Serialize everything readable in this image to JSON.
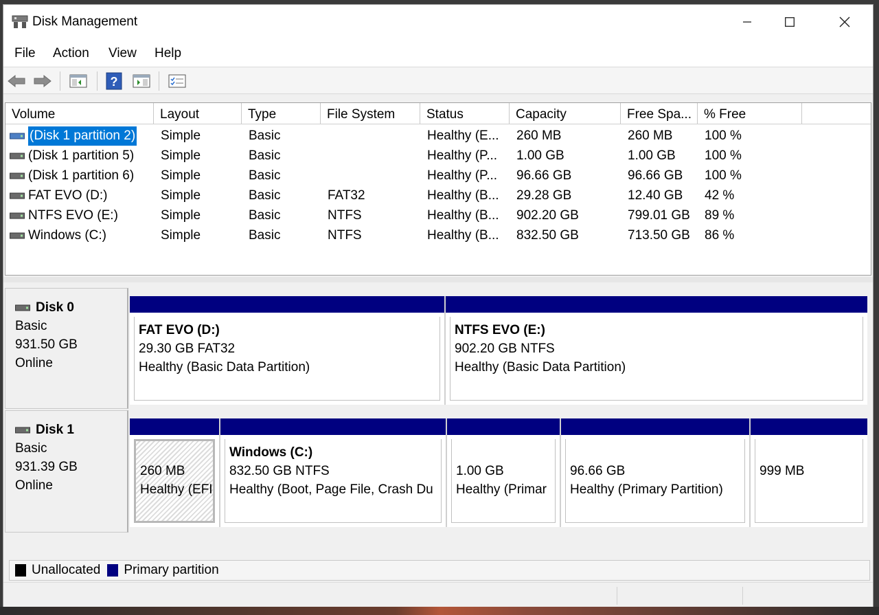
{
  "window": {
    "title": "Disk Management"
  },
  "menu": {
    "items": [
      "File",
      "Action",
      "View",
      "Help"
    ]
  },
  "columns": [
    "Volume",
    "Layout",
    "Type",
    "File System",
    "Status",
    "Capacity",
    "Free Spa...",
    "% Free"
  ],
  "volumes": [
    {
      "volume": "(Disk 1 partition 2)",
      "layout": "Simple",
      "type": "Basic",
      "fs": "",
      "status": "Healthy (E...",
      "capacity": "260 MB",
      "free": "260 MB",
      "pct": "100 %"
    },
    {
      "volume": "(Disk 1 partition 5)",
      "layout": "Simple",
      "type": "Basic",
      "fs": "",
      "status": "Healthy (P...",
      "capacity": "1.00 GB",
      "free": "1.00 GB",
      "pct": "100 %"
    },
    {
      "volume": "(Disk 1 partition 6)",
      "layout": "Simple",
      "type": "Basic",
      "fs": "",
      "status": "Healthy (P...",
      "capacity": "96.66 GB",
      "free": "96.66 GB",
      "pct": "100 %"
    },
    {
      "volume": "FAT EVO (D:)",
      "layout": "Simple",
      "type": "Basic",
      "fs": "FAT32",
      "status": "Healthy (B...",
      "capacity": "29.28 GB",
      "free": "12.40 GB",
      "pct": "42 %"
    },
    {
      "volume": "NTFS EVO (E:)",
      "layout": "Simple",
      "type": "Basic",
      "fs": "NTFS",
      "status": "Healthy (B...",
      "capacity": "902.20 GB",
      "free": "799.01 GB",
      "pct": "89 %"
    },
    {
      "volume": "Windows (C:)",
      "layout": "Simple",
      "type": "Basic",
      "fs": "NTFS",
      "status": "Healthy (B...",
      "capacity": "832.50 GB",
      "free": "713.50 GB",
      "pct": "86 %"
    }
  ],
  "disks": [
    {
      "name": "Disk 0",
      "type": "Basic",
      "size": "931.50 GB",
      "state": "Online",
      "partitions": [
        {
          "name": "FAT EVO  (D:)",
          "size": "29.30 GB FAT32",
          "status": "Healthy (Basic Data Partition)"
        },
        {
          "name": "NTFS EVO  (E:)",
          "size": "902.20 GB NTFS",
          "status": "Healthy (Basic Data Partition)"
        }
      ]
    },
    {
      "name": "Disk 1",
      "type": "Basic",
      "size": "931.39 GB",
      "state": "Online",
      "partitions": [
        {
          "name": "",
          "size": "260 MB",
          "status": "Healthy (EFI"
        },
        {
          "name": "Windows  (C:)",
          "size": "832.50 GB NTFS",
          "status": "Healthy (Boot, Page File, Crash Du"
        },
        {
          "name": "",
          "size": "1.00 GB",
          "status": "Healthy (Primar"
        },
        {
          "name": "",
          "size": "96.66 GB",
          "status": "Healthy (Primary Partition)"
        },
        {
          "name": "",
          "size": "999 MB",
          "status": ""
        }
      ]
    }
  ],
  "legend": {
    "unallocated": "Unallocated",
    "primary": "Primary partition"
  },
  "colors": {
    "primary": "#000080",
    "unallocated": "#000000",
    "selection": "#0078d7"
  },
  "icons": [
    "disk-management-app-icon",
    "back-arrow-icon",
    "forward-arrow-icon",
    "show-hide-console-tree-icon",
    "help-icon",
    "show-action-pane-icon",
    "properties-icon",
    "drive-icon"
  ]
}
